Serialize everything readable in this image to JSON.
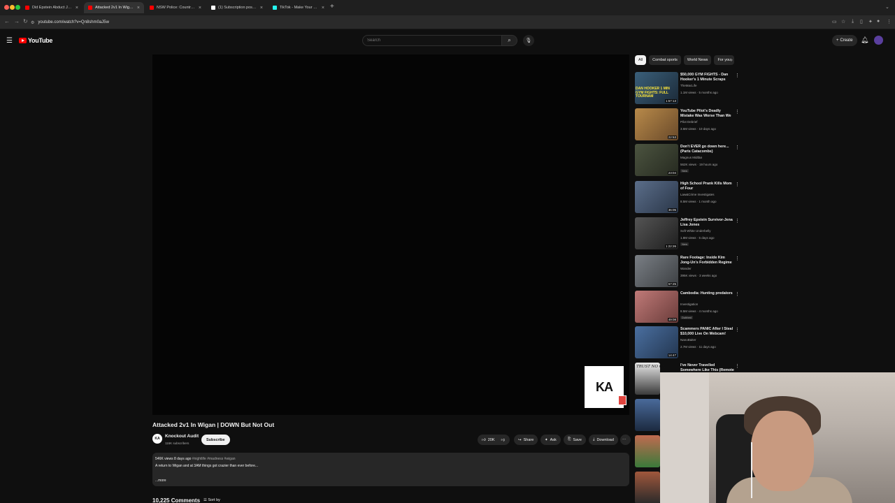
{
  "browser": {
    "tabs": [
      {
        "label": "Did Epstein Abduct JonBenét",
        "fav_color": "#ff0000",
        "active": false
      },
      {
        "label": "Attacked 2v1 In Wigan | D",
        "fav_color": "#ff0000",
        "active": true
      },
      {
        "label": "NSW Police: Country Cop e",
        "fav_color": "#ff0000",
        "active": false
      },
      {
        "label": "(1) Subscription posts by W",
        "fav_color": "#ffffff",
        "active": false
      },
      {
        "label": "TikTok - Make Your Day",
        "fav_color": "#25f4ee",
        "active": false
      }
    ],
    "url": "youtube.com/watch?v=Qn8shm0aJ5w"
  },
  "header": {
    "logo_text": "YouTube",
    "search_placeholder": "Search",
    "create_label": "Create"
  },
  "video": {
    "title": "Attacked 2v1 In Wigan | DOWN But Not Out",
    "channel": "Knockout Audit",
    "channel_initials": "KA",
    "subscribers": "116K subscribers",
    "subscribe_label": "Subscribe",
    "card_text": "KA",
    "likes": "20K",
    "share_label": "Share",
    "ask_label": "Ask",
    "save_label": "Save",
    "download_label": "Download",
    "views_date": "546K views  8 days ago",
    "hashtags": "#nightlife #madness #wigan",
    "description": "A return to Wigan and at 3AM things got crazier than ever before...",
    "more_label": "...more",
    "comments_count": "10,225 Comments",
    "sort_label": "Sort by"
  },
  "sidebar": {
    "chips": [
      "All",
      "Combat sports",
      "World News",
      "For you"
    ],
    "recommendations": [
      {
        "title": "$50,000 GYM FIGHTS - Dan Hooker's 1 Minute Scraps",
        "channel": "TheMacLife",
        "views": "1.1M views · 5 months ago",
        "duration": "1:57:13",
        "badge": "",
        "thumb_color": "#3a5f7a"
      },
      {
        "title": "YouTube Pilot's Deadly Mistake Was Worse Than We Thought!",
        "channel": "Pilot Debrief",
        "views": "3.6M views · 10 days ago",
        "duration": "22:53",
        "badge": "",
        "thumb_color": "#b88a4a"
      },
      {
        "title": "Don't EVER go down here... (Paris Catacombs)",
        "channel": "Magnus Midtbø",
        "views": "562K views · 19 hours ago",
        "duration": "23:04",
        "badge": "New",
        "thumb_color": "#4c5440"
      },
      {
        "title": "High School Prank Kills Mom of Four",
        "channel": "Law&Crime Investigates",
        "views": "8.5M views · 1 month ago",
        "duration": "36:05",
        "badge": "",
        "thumb_color": "#5b6e8a"
      },
      {
        "title": "Jeffrey Epstein Survivor-Jena Lisa Jones",
        "channel": "Soft White Underbelly",
        "views": "1.8M views · 5 days ago",
        "duration": "1:22:26",
        "badge": "New",
        "thumb_color": "#3a3a3a"
      },
      {
        "title": "Rare Footage: Inside Kim Jong-Un's Forbidden Regime",
        "channel": "Wander",
        "views": "395K views · 3 weeks ago",
        "duration": "57:25",
        "badge": "",
        "thumb_color": "#7a7f85"
      },
      {
        "title": "Cambodia: Hunting predators",
        "channel": "Investigation",
        "views": "8.5M views · 4 months ago",
        "duration": "49:08",
        "badge": "Dubbed",
        "thumb_color": "#c07a78"
      },
      {
        "title": "Scammers PANIC After I Steal $10,000 Live On Webcam!",
        "channel": "NanoBaiter",
        "views": "2.7M views · 11 days ago",
        "duration": "14:47",
        "badge": "",
        "thumb_color": "#4a6fa0"
      },
      {
        "title": "I've Never Travelled Somewhere Like This (Remote PNG)",
        "channel": "",
        "views": "",
        "duration": "",
        "badge": "",
        "thumb_color": "#d8d8d8"
      }
    ],
    "thumb_overlay_text": [
      "DAN HOOKER 1 MIN GYM FIGHTS: FULL TOURNAM",
      "TRUST NO ONE"
    ]
  },
  "colors": {
    "accent": "#ff0000",
    "bg": "#0f0f0f",
    "pill": "#272727"
  }
}
